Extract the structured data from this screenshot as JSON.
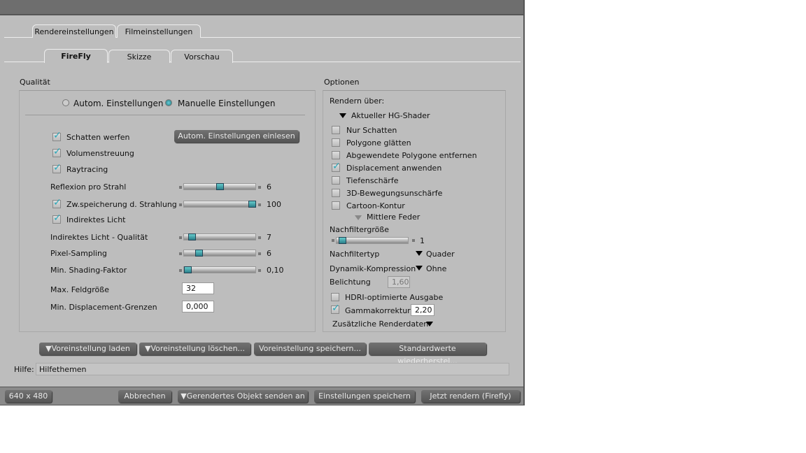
{
  "tabs_top": [
    "Rendereinstellungen",
    "Filmeinstellungen"
  ],
  "tabs_sub": [
    "FireFly",
    "Skizze",
    "Vorschau"
  ],
  "quality": {
    "title": "Qualität",
    "radio_auto": "Autom. Einstellungen",
    "radio_manual": "Manuelle Einstellungen",
    "selected": "manual",
    "auto_button": "Autom. Einstellungen einlesen",
    "checks": [
      {
        "label": "Schatten werfen",
        "checked": true
      },
      {
        "label": "Volumenstreuung",
        "checked": true
      },
      {
        "label": "Raytracing",
        "checked": true
      },
      {
        "label": "Zw.speicherung d. Strahlung",
        "checked": true
      },
      {
        "label": "Indirektes Licht",
        "checked": true
      }
    ],
    "sliders": [
      {
        "label": "Reflexion pro Strahl",
        "value": "6",
        "fraction": 0.5
      },
      {
        "label": "",
        "value": "100",
        "fraction": 1.0
      },
      {
        "label": "Indirektes Licht - Qualität",
        "value": "7",
        "fraction": 0.06
      },
      {
        "label": "Pixel-Sampling",
        "value": "6",
        "fraction": 0.17
      },
      {
        "label": "Min. Shading-Faktor",
        "value": "0,10",
        "fraction": 0.0
      }
    ],
    "max_field_label": "Max. Feldgröße",
    "max_field_value": "32",
    "min_disp_label": "Min. Displacement-Grenzen",
    "min_disp_value": "0,000"
  },
  "options": {
    "title": "Optionen",
    "render_via": "Rendern über:",
    "shader": "Aktueller HG-Shader",
    "checks": [
      {
        "label": "Nur Schatten",
        "checked": false
      },
      {
        "label": "Polygone glätten",
        "checked": false
      },
      {
        "label": "Abgewendete Polygone entfernen",
        "checked": false
      },
      {
        "label": "Displacement anwenden",
        "checked": true
      },
      {
        "label": "Tiefenschärfe",
        "checked": false
      },
      {
        "label": "3D-Bewegungsunschärfe",
        "checked": false
      },
      {
        "label": "Cartoon-Kontur",
        "checked": false
      }
    ],
    "cartoon_style": "Mittlere Feder",
    "filter_size_label": "Nachfiltergröße",
    "filter_size_value": "1",
    "filter_size_fraction": 0.03,
    "filter_type_label": "Nachfiltertyp",
    "filter_type": "Quader",
    "dyn_label": "Dynamik-Kompression",
    "dyn_value": "Ohne",
    "exposure_label": "Belichtung",
    "exposure_value": "1,60",
    "hdri_label": "HDRI-optimierte Ausgabe",
    "gamma_label": "Gammakorrektur",
    "gamma_value": "2,20",
    "extra": "Zusätzliche Renderdaten"
  },
  "presets": [
    "Voreinstellung laden",
    "Voreinstellung löschen...",
    "Voreinstellung speichern...",
    "Standardwerte wiederherstel..."
  ],
  "help": {
    "label": "Hilfe:",
    "value": "Hilfethemen"
  },
  "bottom": {
    "size": "640 x 480",
    "cancel": "Abbrechen",
    "send": "Gerendertes Objekt senden an",
    "save": "Einstellungen speichern",
    "render": "Jetzt rendern (Firefly)"
  }
}
